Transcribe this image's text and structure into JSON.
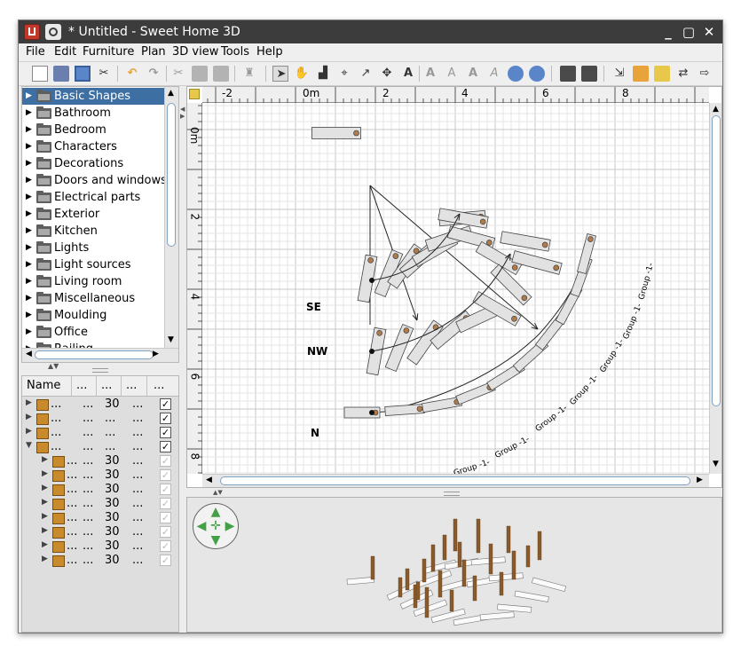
{
  "window": {
    "title": "* Untitled - Sweet Home 3D",
    "controls": [
      "_",
      "▢",
      "✕"
    ]
  },
  "menu": [
    "File",
    "Edit",
    "Furniture",
    "Plan",
    "3D view",
    "Tools",
    "Help"
  ],
  "toolbar": {
    "icons": [
      "new-home-icon",
      "open-icon",
      "save-icon",
      "cut-icon",
      "undo-icon",
      "redo-icon",
      "cut-icon",
      "copy-icon",
      "paste-icon",
      "add-furniture-icon",
      "select-mode-icon",
      "pan-mode-icon",
      "create-walls-icon",
      "create-rooms-icon",
      "create-polylines-icon",
      "create-dimensions-icon",
      "add-text-icon",
      "increase-text-size-icon",
      "decrease-text-size-icon",
      "bold-icon",
      "italic-icon",
      "zoom-in-icon",
      "zoom-out-icon",
      "create-photo-icon",
      "create-video-icon",
      "import-furniture-icon",
      "import-texture-icon",
      "import-background-icon",
      "preferences-icon",
      "help-icon"
    ]
  },
  "catalog": {
    "categories": [
      "Basic Shapes",
      "Bathroom",
      "Bedroom",
      "Characters",
      "Decorations",
      "Doors and windows",
      "Electrical parts",
      "Exterior",
      "Kitchen",
      "Lights",
      "Light sources",
      "Living room",
      "Miscellaneous",
      "Moulding",
      "Office",
      "Railing"
    ],
    "selected": "Basic Shapes"
  },
  "furniture_table": {
    "columns": [
      "Name",
      "...",
      "...",
      "...",
      "..."
    ],
    "rows": [
      {
        "name": "...",
        "c2": "...",
        "c3": "30",
        "c4": "...",
        "visible": true,
        "level": 0,
        "expanded": false,
        "check_enabled": true
      },
      {
        "name": "...",
        "c2": "...",
        "c3": "...",
        "c4": "...",
        "visible": true,
        "level": 0,
        "expanded": false,
        "check_enabled": true
      },
      {
        "name": "...",
        "c2": "...",
        "c3": "...",
        "c4": "...",
        "visible": true,
        "level": 0,
        "expanded": false,
        "check_enabled": true
      },
      {
        "name": "...",
        "c2": "...",
        "c3": "...",
        "c4": "...",
        "visible": true,
        "level": 0,
        "expanded": true,
        "check_enabled": true
      },
      {
        "name": "...",
        "c2": "...",
        "c3": "30",
        "c4": "...",
        "visible": true,
        "level": 1,
        "expanded": false,
        "check_enabled": false
      },
      {
        "name": "...",
        "c2": "...",
        "c3": "30",
        "c4": "...",
        "visible": true,
        "level": 1,
        "expanded": false,
        "check_enabled": false
      },
      {
        "name": "...",
        "c2": "...",
        "c3": "30",
        "c4": "...",
        "visible": true,
        "level": 1,
        "expanded": false,
        "check_enabled": false
      },
      {
        "name": "...",
        "c2": "...",
        "c3": "30",
        "c4": "...",
        "visible": true,
        "level": 1,
        "expanded": false,
        "check_enabled": false
      },
      {
        "name": "...",
        "c2": "...",
        "c3": "30",
        "c4": "...",
        "visible": true,
        "level": 1,
        "expanded": false,
        "check_enabled": false
      },
      {
        "name": "...",
        "c2": "...",
        "c3": "30",
        "c4": "...",
        "visible": true,
        "level": 1,
        "expanded": false,
        "check_enabled": false
      },
      {
        "name": "...",
        "c2": "...",
        "c3": "30",
        "c4": "...",
        "visible": true,
        "level": 1,
        "expanded": false,
        "check_enabled": false
      },
      {
        "name": "...",
        "c2": "...",
        "c3": "30",
        "c4": "...",
        "visible": true,
        "level": 1,
        "expanded": false,
        "check_enabled": false
      }
    ]
  },
  "plan": {
    "ruler_top": [
      "-2",
      "0m",
      "2",
      "4",
      "6",
      "8"
    ],
    "ruler_left": [
      "0m",
      "2",
      "4",
      "6",
      "8"
    ],
    "labels": [
      "SE",
      "NW",
      "N"
    ],
    "group_label": "Group -1-"
  }
}
